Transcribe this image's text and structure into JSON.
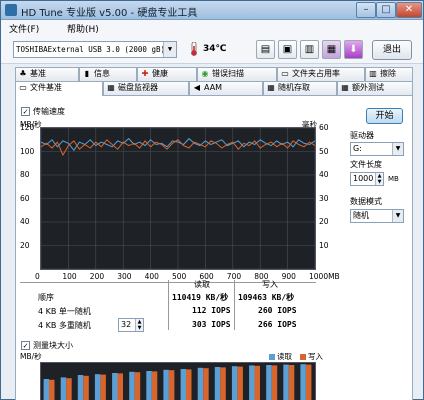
{
  "window": {
    "title": "HD Tune 专业版 v5.00 - 硬盘专业工具",
    "controls": {
      "minimize": "–",
      "maximize": "□",
      "close": "✕"
    }
  },
  "menu": {
    "items": [
      "文件(F)",
      "帮助(H)"
    ]
  },
  "toolbar": {
    "drive": "TOSHIBAExternal USB 3.0 (2000 gB)",
    "temperature": "34℃",
    "exit_label": "退出",
    "icons": [
      "copy-info-icon",
      "copy-save-icon",
      "screenshot-icon",
      "options-icon",
      "download-icon"
    ]
  },
  "tabs_top": [
    {
      "label": "基准",
      "icon": "♣"
    },
    {
      "label": "信息",
      "icon": "▮"
    },
    {
      "label": "健康",
      "icon": "✚"
    },
    {
      "label": "错误扫描",
      "icon": "◉"
    },
    {
      "label": "文件夹占用率",
      "icon": "▭"
    },
    {
      "label": "擦除",
      "icon": "▥"
    }
  ],
  "tabs_bottom": [
    {
      "label": "文件基准",
      "icon": "▭"
    },
    {
      "label": "磁盘监视器",
      "icon": "▦"
    },
    {
      "label": "AAM",
      "icon": "◀"
    },
    {
      "label": "随机存取",
      "icon": "▦"
    },
    {
      "label": "额外测试",
      "icon": "▦"
    }
  ],
  "file_benchmark": {
    "transfer_check_label": "传输速度",
    "transfer_checked": true,
    "start_button": "开始",
    "drive_label": "驱动器",
    "drive_value": "G:",
    "file_length_label": "文件长度",
    "file_length_value": "1000",
    "file_length_unit": "MB",
    "data_mode_label": "数据模式",
    "data_mode_value": "随机",
    "block_check_label": "测量块大小",
    "block_checked": true
  },
  "results": {
    "header_read": "读取",
    "header_write": "写入",
    "rows": [
      {
        "label": "顺序",
        "read": "110419 KB/秒",
        "write": "109463 KB/秒"
      },
      {
        "label": "4 KB 单一随机",
        "read": "112 IOPS",
        "write": "260 IOPS"
      },
      {
        "label": "4 KB 多重随机",
        "queue": "32",
        "read": "303 IOPS",
        "write": "266 IOPS"
      }
    ]
  },
  "chart_data": [
    {
      "type": "line",
      "title": "",
      "ylabel": "MB/秒",
      "y2label": "毫秒",
      "xlabel": "MB",
      "xlim": [
        0,
        1000
      ],
      "ylim": [
        0,
        120
      ],
      "y2lim": [
        0,
        60
      ],
      "x_ticks": [
        "0",
        "100",
        "200",
        "300",
        "400",
        "500",
        "600",
        "700",
        "800",
        "900",
        "1000MB"
      ],
      "y_ticks": [
        "120",
        "100",
        "80",
        "60",
        "40",
        "20"
      ],
      "y2_ticks": [
        "60",
        "50",
        "40",
        "30",
        "20",
        "10"
      ],
      "colors": {
        "read": "#5aa0d6",
        "write": "#d8652c",
        "background": "#1e2226"
      },
      "series": [
        {
          "name": "读取",
          "x": [
            0,
            20,
            40,
            60,
            80,
            100,
            120,
            140,
            160,
            180,
            200,
            220,
            240,
            260,
            280,
            300,
            320,
            340,
            360,
            380,
            400,
            420,
            440,
            460,
            480,
            500,
            520,
            540,
            560,
            580,
            600,
            620,
            640,
            660,
            680,
            700,
            720,
            740,
            760,
            780,
            800,
            820,
            840,
            860,
            880,
            900,
            920,
            940,
            960,
            980,
            1000
          ],
          "y": [
            108,
            106,
            110,
            104,
            109,
            107,
            101,
            108,
            106,
            110,
            105,
            108,
            106,
            104,
            109,
            107,
            111,
            106,
            108,
            105,
            110,
            106,
            107,
            104,
            109,
            108,
            106,
            111,
            107,
            105,
            109,
            106,
            108,
            110,
            105,
            107,
            109,
            104,
            108,
            106,
            110,
            107,
            105,
            109,
            106,
            108,
            104,
            110,
            107,
            106,
            109
          ]
        },
        {
          "name": "写入",
          "x": [
            0,
            20,
            40,
            60,
            80,
            100,
            120,
            140,
            160,
            180,
            200,
            220,
            240,
            260,
            280,
            300,
            320,
            340,
            360,
            380,
            400,
            420,
            440,
            460,
            480,
            500,
            520,
            540,
            560,
            580,
            600,
            620,
            640,
            660,
            680,
            700,
            720,
            740,
            760,
            780,
            800,
            820,
            840,
            860,
            880,
            900,
            920,
            940,
            960,
            980,
            1000
          ],
          "y": [
            104,
            107,
            103,
            108,
            97,
            105,
            109,
            102,
            106,
            103,
            108,
            104,
            110,
            106,
            102,
            108,
            105,
            107,
            103,
            109,
            104,
            108,
            106,
            102,
            107,
            110,
            105,
            103,
            108,
            106,
            104,
            109,
            107,
            103,
            106,
            108,
            102,
            107,
            105,
            109,
            103,
            106,
            108,
            104,
            107,
            103,
            109,
            106,
            104,
            108,
            105
          ]
        }
      ]
    },
    {
      "type": "bar",
      "ylabel": "MB/秒",
      "legend": [
        "读取",
        "写入"
      ],
      "legend_position": "top-right",
      "colors": {
        "read": "#5aa0d6",
        "write": "#d8652c"
      },
      "series": [
        {
          "name": "读取",
          "values": [
            60,
            64,
            70,
            72,
            75,
            78,
            80,
            83,
            85,
            88,
            90,
            92,
            94,
            95,
            96,
            97
          ]
        },
        {
          "name": "写入",
          "values": [
            58,
            62,
            68,
            71,
            74,
            77,
            79,
            82,
            84,
            87,
            89,
            91,
            93,
            94,
            95,
            96
          ]
        }
      ]
    }
  ]
}
